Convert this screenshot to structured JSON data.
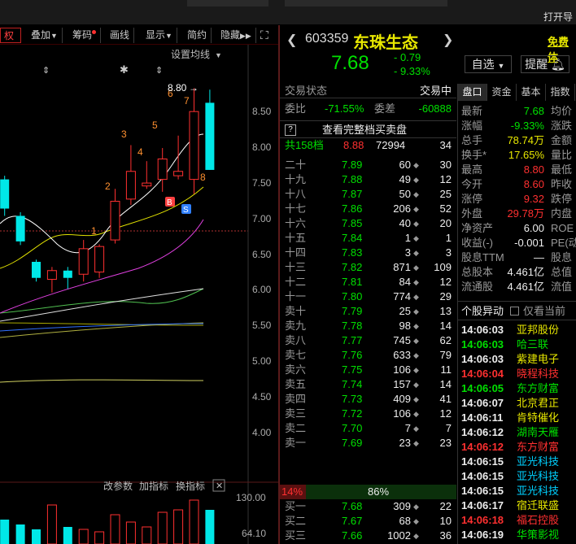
{
  "window": {
    "open_label": "打开导"
  },
  "toolbar": {
    "items": [
      {
        "label": "权",
        "dot": false
      },
      {
        "label": "叠加",
        "dot": false
      },
      {
        "label": "筹码",
        "dot": true
      },
      {
        "label": "画线",
        "dot": false
      },
      {
        "label": "显示",
        "dot": false
      },
      {
        "label": "简约",
        "dot": false
      },
      {
        "label": "隐藏",
        "dot": false
      }
    ]
  },
  "chart": {
    "settings_label": "设置均线",
    "max_label": "8.80",
    "price_ticks": [
      "8.50",
      "8.00",
      "7.50",
      "7.00",
      "6.50",
      "6.00",
      "5.50",
      "5.00",
      "4.50",
      "4.00"
    ],
    "day_labels": [
      "1",
      "2",
      "3",
      "4",
      "5",
      "6",
      "7",
      "8"
    ],
    "buy_marker": "B",
    "sell_marker": "S",
    "bottom_tabs": [
      "改参数",
      "加指标",
      "换指标"
    ],
    "close_x": "✕",
    "volume_ticks": [
      "130.00",
      "64.10"
    ]
  },
  "chart_data": {
    "type": "candlestick",
    "ylim": [
      3.6,
      8.95
    ],
    "candles": [
      {
        "o": 7.15,
        "c": 7.55,
        "h": 7.6,
        "l": 7.05,
        "up": false
      },
      {
        "o": 6.7,
        "c": 7.05,
        "h": 7.1,
        "l": 6.65,
        "up": false
      },
      {
        "o": 6.2,
        "c": 6.42,
        "h": 6.45,
        "l": 6.15,
        "up": false
      },
      {
        "o": 6.18,
        "c": 6.3,
        "h": 6.35,
        "l": 6.0,
        "up": true
      },
      {
        "o": 6.2,
        "c": 6.3,
        "h": 6.35,
        "l": 6.05,
        "up": false
      },
      {
        "o": 6.25,
        "c": 6.6,
        "h": 6.72,
        "l": 6.15,
        "up": true
      },
      {
        "o": 6.28,
        "c": 6.63,
        "h": 6.66,
        "l": 6.2,
        "up": true
      },
      {
        "o": 6.72,
        "c": 7.25,
        "h": 7.42,
        "l": 6.67,
        "up": true
      },
      {
        "o": 7.28,
        "c": 7.66,
        "h": 8.02,
        "l": 7.2,
        "up": true
      },
      {
        "o": 7.46,
        "c": 7.5,
        "h": 7.8,
        "l": 7.42,
        "up": true
      },
      {
        "o": 7.55,
        "c": 7.83,
        "h": 7.98,
        "l": 7.38,
        "up": true
      },
      {
        "o": 7.6,
        "c": 7.66,
        "h": 8.15,
        "l": 7.55,
        "up": true
      },
      {
        "o": 7.55,
        "c": 8.48,
        "h": 8.8,
        "l": 7.35,
        "up": true
      },
      {
        "o": 8.6,
        "c": 7.68,
        "h": 8.78,
        "l": 7.68,
        "up": false
      }
    ],
    "volume": [
      0.5,
      0.4,
      0.3,
      0.8,
      0.35,
      0.3,
      0.25,
      0.6,
      0.45,
      0.35,
      0.65,
      0.7,
      0.9,
      0.7
    ]
  },
  "header": {
    "code": "603359",
    "name": "东珠生态",
    "price": "7.68",
    "change": "- 0.79",
    "change_pct": "- 9.33%",
    "watchlist_btn": "自选",
    "remind_btn": "提醒",
    "free_label": "免费体"
  },
  "orderbook": {
    "status_label": "交易状态",
    "status_value": "交易中",
    "ratio_label": "委比",
    "ratio_value": "-71.55%",
    "diff_label": "委差",
    "diff_value": "-60888",
    "full_book_btn": "查看完整档买卖盘",
    "total_label": "共158档",
    "total_price": "8.88",
    "total_vol": "72994",
    "total_count": "34",
    "asks": [
      {
        "label": "二十",
        "price": "7.89",
        "vol": "60",
        "cnt": "30"
      },
      {
        "label": "十九",
        "price": "7.88",
        "vol": "49",
        "cnt": "12"
      },
      {
        "label": "十八",
        "price": "7.87",
        "vol": "50",
        "cnt": "25"
      },
      {
        "label": "十七",
        "price": "7.86",
        "vol": "206",
        "cnt": "52"
      },
      {
        "label": "十六",
        "price": "7.85",
        "vol": "40",
        "cnt": "20"
      },
      {
        "label": "十五",
        "price": "7.84",
        "vol": "1",
        "cnt": "1"
      },
      {
        "label": "十四",
        "price": "7.83",
        "vol": "3",
        "cnt": "3"
      },
      {
        "label": "十三",
        "price": "7.82",
        "vol": "871",
        "cnt": "109"
      },
      {
        "label": "十二",
        "price": "7.81",
        "vol": "84",
        "cnt": "12"
      },
      {
        "label": "十一",
        "price": "7.80",
        "vol": "774",
        "cnt": "29"
      },
      {
        "label": "卖十",
        "price": "7.79",
        "vol": "25",
        "cnt": "13"
      },
      {
        "label": "卖九",
        "price": "7.78",
        "vol": "98",
        "cnt": "14"
      },
      {
        "label": "卖八",
        "price": "7.77",
        "vol": "745",
        "cnt": "62"
      },
      {
        "label": "卖七",
        "price": "7.76",
        "vol": "633",
        "cnt": "79"
      },
      {
        "label": "卖六",
        "price": "7.75",
        "vol": "106",
        "cnt": "11"
      },
      {
        "label": "卖五",
        "price": "7.74",
        "vol": "157",
        "cnt": "14"
      },
      {
        "label": "卖四",
        "price": "7.73",
        "vol": "409",
        "cnt": "41"
      },
      {
        "label": "卖三",
        "price": "7.72",
        "vol": "106",
        "cnt": "12"
      },
      {
        "label": "卖二",
        "price": "7.70",
        "vol": "7",
        "cnt": "7"
      },
      {
        "label": "卖一",
        "price": "7.69",
        "vol": "23",
        "cnt": "23"
      }
    ],
    "sell_pct": "14%",
    "buy_pct": "86%",
    "bids": [
      {
        "label": "买一",
        "price": "7.68",
        "vol": "309",
        "cnt": "22"
      },
      {
        "label": "买二",
        "price": "7.67",
        "vol": "68",
        "cnt": "10"
      },
      {
        "label": "买三",
        "price": "7.66",
        "vol": "1002",
        "cnt": "36"
      }
    ]
  },
  "right_panel": {
    "tabs": [
      "盘口",
      "资金",
      "基本",
      "指数"
    ],
    "stats": [
      {
        "l": "最新",
        "v": "7.68",
        "c": "green",
        "r": "均价"
      },
      {
        "l": "涨幅",
        "v": "-9.33%",
        "c": "green",
        "r": "涨跌"
      },
      {
        "l": "总手",
        "v": "78.74万",
        "c": "yellow",
        "r": "金额"
      },
      {
        "l": "换手*",
        "v": "17.65%",
        "c": "yellow",
        "r": "量比"
      },
      {
        "l": "最高",
        "v": "8.80",
        "c": "red",
        "r": "最低"
      },
      {
        "l": "今开",
        "v": "8.60",
        "c": "red",
        "r": "昨收"
      },
      {
        "l": "涨停",
        "v": "9.32",
        "c": "red",
        "r": "跌停"
      },
      {
        "l": "外盘",
        "v": "29.78万",
        "c": "red",
        "r": "内盘"
      },
      {
        "l": "净资产",
        "v": "6.00",
        "c": "white",
        "r": "ROE"
      },
      {
        "l": "收益(-)",
        "v": "-0.001",
        "c": "white",
        "r": "PE(动"
      },
      {
        "l": "股息TTM",
        "v": "—",
        "c": "white",
        "r": "股息"
      },
      {
        "l": "总股本",
        "v": "4.461亿",
        "c": "white",
        "r": "总值"
      },
      {
        "l": "流通股",
        "v": "4.461亿",
        "c": "white",
        "r": "流值"
      }
    ],
    "anomaly_title": "个股异动",
    "anomaly_opt": "仅看当前",
    "anomalies": [
      {
        "t": "14:06:03",
        "n": "亚邦股份",
        "tc": "white",
        "nc": "yellow"
      },
      {
        "t": "14:06:03",
        "n": "哈三联",
        "tc": "green",
        "nc": "green"
      },
      {
        "t": "14:06:03",
        "n": "紫建电子",
        "tc": "white",
        "nc": "yellow"
      },
      {
        "t": "14:06:04",
        "n": "晓程科技",
        "tc": "red",
        "nc": "red"
      },
      {
        "t": "14:06:05",
        "n": "东方财富",
        "tc": "green",
        "nc": "green"
      },
      {
        "t": "14:06:07",
        "n": "北京君正",
        "tc": "white",
        "nc": "yellow"
      },
      {
        "t": "14:06:11",
        "n": "肯特催化",
        "tc": "white",
        "nc": "yellow"
      },
      {
        "t": "14:06:12",
        "n": "湖南天雁",
        "tc": "white",
        "nc": "green"
      },
      {
        "t": "14:06:12",
        "n": "东方财富",
        "tc": "red",
        "nc": "red"
      },
      {
        "t": "14:06:15",
        "n": "亚光科技",
        "tc": "white",
        "nc": "cyan"
      },
      {
        "t": "14:06:15",
        "n": "亚光科技",
        "tc": "white",
        "nc": "cyan"
      },
      {
        "t": "14:06:15",
        "n": "亚光科技",
        "tc": "white",
        "nc": "cyan"
      },
      {
        "t": "14:06:17",
        "n": "宿迁联盛",
        "tc": "white",
        "nc": "yellow"
      },
      {
        "t": "14:06:18",
        "n": "福石控股",
        "tc": "red",
        "nc": "red"
      },
      {
        "t": "14:06:19",
        "n": "华策影视",
        "tc": "white",
        "nc": "green"
      }
    ]
  }
}
